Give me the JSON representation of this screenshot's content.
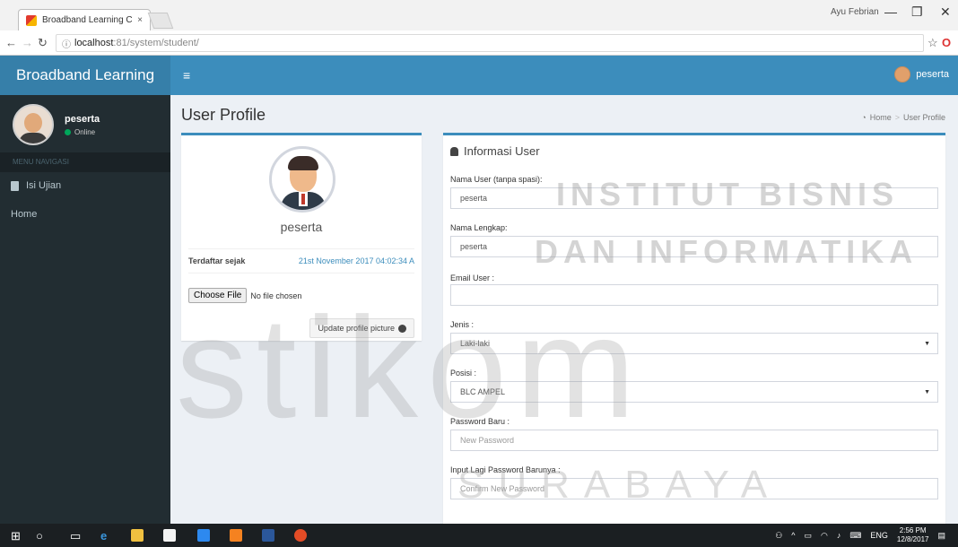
{
  "browser": {
    "tab_title": "Broadband Learning Cen",
    "tab_close": "×",
    "window_user": "Ayu Febrian",
    "win_min": "—",
    "win_max": "❐",
    "win_close": "✕",
    "url_host": "localhost",
    "url_path": ":81/system/student/"
  },
  "app": {
    "brand": "Broadband Learning",
    "nav_user": "peserta"
  },
  "sidebar": {
    "user_name": "peserta",
    "status": "Online",
    "menu_header": "MENU NAVIGASI",
    "items": [
      {
        "label": "Isi Ujian"
      },
      {
        "label": "Home"
      }
    ]
  },
  "content": {
    "title": "User Profile",
    "breadcrumb": {
      "home": "Home",
      "sep": ">",
      "current": "User Profile"
    }
  },
  "profile": {
    "name": "peserta",
    "registered_label": "Terdaftar sejak",
    "registered_value": "21st November 2017 04:02:34 A",
    "choose_file": "Choose File",
    "no_file": "No file chosen",
    "update_button": "Update profile picture"
  },
  "info": {
    "title": "Informasi User",
    "fields": {
      "username_label": "Nama User (tanpa spasi):",
      "username_value": "peserta",
      "fullname_label": "Nama Lengkap:",
      "fullname_value": "peserta",
      "email_label": "Email User :",
      "email_value": "",
      "jenis_label": "Jenis :",
      "jenis_value": "Laki-laki",
      "posisi_label": "Posisi :",
      "posisi_value": "BLC AMPEL",
      "password_label": "Password Baru :",
      "password_placeholder": "New Password",
      "confirm_label": "Input Lagi Password Barunya :",
      "confirm_placeholder": "Confirm New Password"
    }
  },
  "watermark": {
    "line1": "INSTITUT BISNIS",
    "line2": "DAN INFORMATIKA",
    "main": "stikom",
    "city": "SURABAYA"
  },
  "taskbar": {
    "lang": "ENG",
    "time": "2:56 PM",
    "date": "12/8/2017"
  },
  "colors": {
    "header_blue": "#3c8dbc",
    "brand_blue": "#367fa9",
    "sidebar_dark": "#222d32",
    "online_green": "#00a65a"
  }
}
